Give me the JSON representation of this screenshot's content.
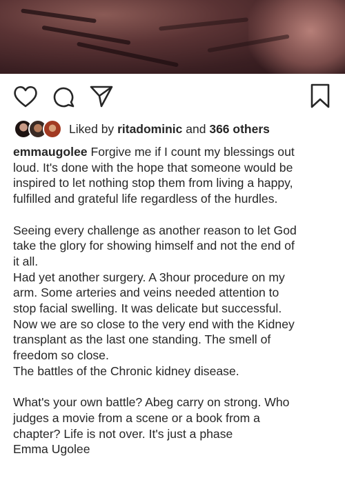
{
  "post": {
    "image_alt": "photo of arm after surgery"
  },
  "actions": {
    "like_icon": "heart-outline-icon",
    "comment_icon": "comment-bubble-icon",
    "share_icon": "paper-plane-icon",
    "save_icon": "bookmark-icon"
  },
  "likes": {
    "prefix": "Liked by",
    "user": "ritadominic",
    "connector": "and",
    "others": "366 others"
  },
  "caption": {
    "author": "emmaugolee",
    "lines": [
      "Forgive me if I count my blessings out",
      "loud.  It's done with the hope that someone would be",
      "inspired to let nothing stop them from living a happy,",
      "fulfilled and grateful life regardless of the hurdles.",
      "",
      "Seeing every challenge as another reason to let God",
      "take the glory for showing himself and not the end of",
      "it all.",
      "Had yet another surgery. A 3hour procedure on my",
      "arm. Some arteries and veins needed attention to",
      "stop facial swelling. It was delicate but successful.",
      "Now we are so close to the very end with the Kidney",
      "transplant as the last one standing. The smell of",
      "freedom so close.",
      "The battles of the Chronic kidney disease.",
      "",
      "What's your own battle? Abeg carry on strong. Who",
      "judges a movie from a scene or a book from a",
      "chapter? Life is not over. It's just a phase",
      "Emma Ugolee"
    ]
  }
}
